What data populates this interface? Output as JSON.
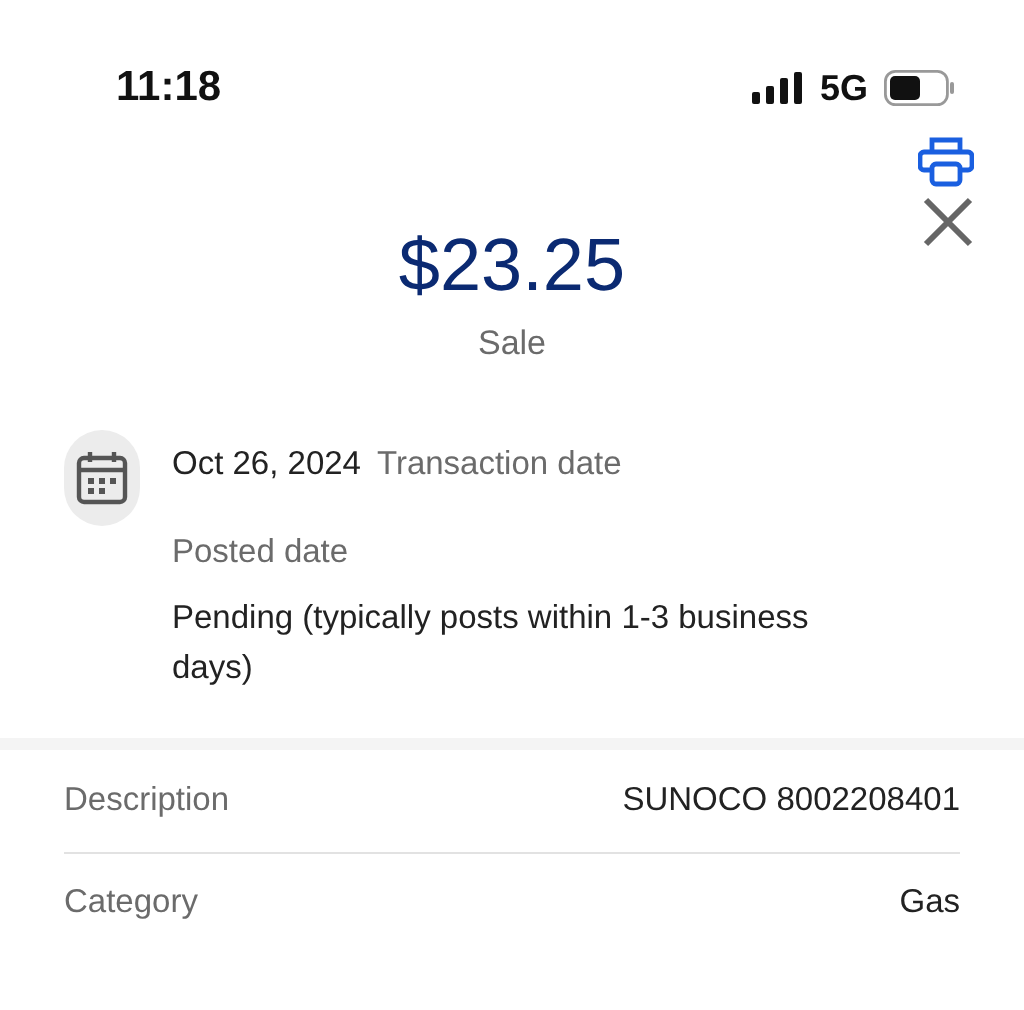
{
  "status_bar": {
    "time": "11:18",
    "network": "5G"
  },
  "amount": "$23.25",
  "type": "Sale",
  "dates": {
    "transaction_date": "Oct 26, 2024",
    "transaction_label": "Transaction date",
    "posted_label": "Posted date",
    "posted_value": "Pending (typically posts within 1-3 business days)"
  },
  "details": [
    {
      "label": "Description",
      "value": "SUNOCO 8002208401"
    },
    {
      "label": "Category",
      "value": "Gas"
    }
  ]
}
